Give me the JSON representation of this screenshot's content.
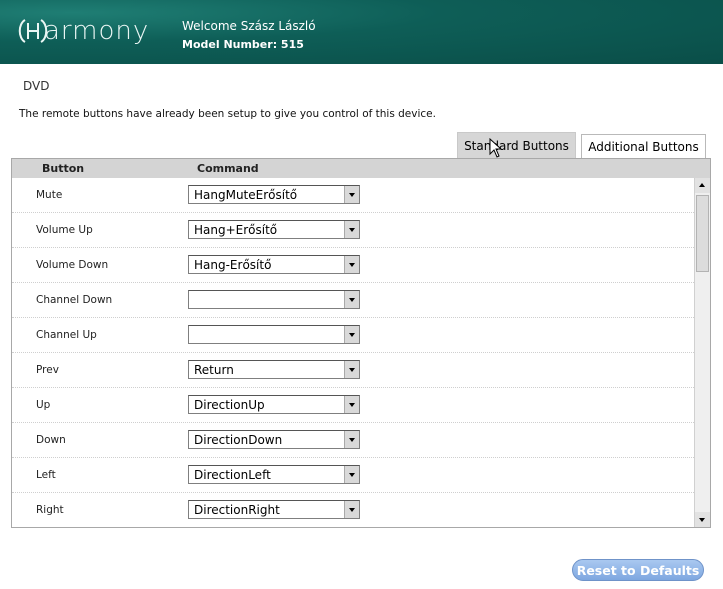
{
  "header": {
    "logo_text": "armony",
    "welcome": "Welcome Szász László",
    "model": "Model Number: 515"
  },
  "device": {
    "title": "DVD",
    "description": "The remote buttons have already been setup to give you control of this device."
  },
  "tabs": [
    {
      "label": "Standard Buttons",
      "active": true
    },
    {
      "label": "Additional Buttons",
      "active": false
    }
  ],
  "table": {
    "columns": [
      "Button",
      "Command"
    ],
    "rows": [
      {
        "button": "Mute",
        "command": "HangMuteErősítő"
      },
      {
        "button": "Volume Up",
        "command": "Hang+Erősítő"
      },
      {
        "button": "Volume Down",
        "command": "Hang-Erősítő"
      },
      {
        "button": "Channel Down",
        "command": ""
      },
      {
        "button": "Channel Up",
        "command": ""
      },
      {
        "button": "Prev",
        "command": "Return"
      },
      {
        "button": "Up",
        "command": "DirectionUp"
      },
      {
        "button": "Down",
        "command": "DirectionDown"
      },
      {
        "button": "Left",
        "command": "DirectionLeft"
      },
      {
        "button": "Right",
        "command": "DirectionRight"
      }
    ]
  },
  "actions": {
    "reset_label": "Reset to Defaults"
  },
  "colors": {
    "header_bg": "#0e5e57",
    "reset_button": "#7ea7e0"
  }
}
